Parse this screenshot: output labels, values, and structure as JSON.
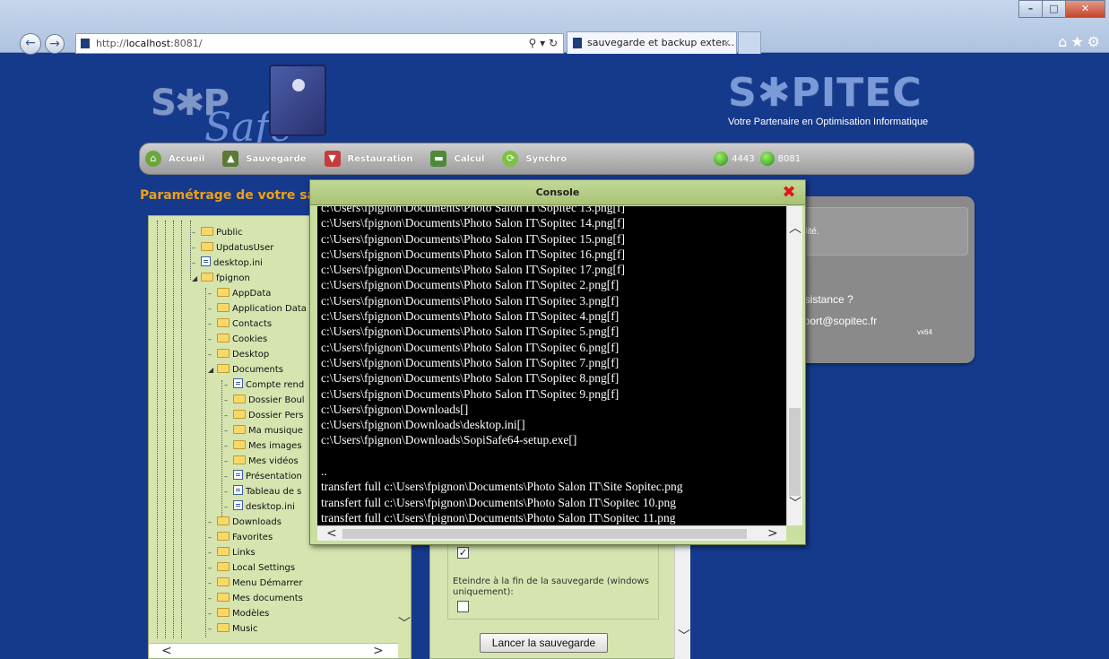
{
  "browser": {
    "address_prefix": "http://",
    "address_host": "localhost",
    "address_rest": ":8081/",
    "address_tools": "⚲ ▾ ↻",
    "tab_title": "sauvegarde et backup exter...",
    "tab_close": "×",
    "window_buttons": {
      "minimize": "–",
      "maximize": "□",
      "close": "✕"
    },
    "back_icon": "←",
    "forward_icon": "→",
    "right_icons": "⌂★⚙"
  },
  "header": {
    "sopisafe_word": "S✱P",
    "sopisafe_script": "Safe",
    "sopitec_brand": "S✱PITEC",
    "sopitec_tagline": "Votre Partenaire en Optimisation Informatique"
  },
  "menu": {
    "items": [
      {
        "label": "Accueil",
        "icon": "home-icon",
        "color": "#6aa63a"
      },
      {
        "label": "Sauvegarde",
        "icon": "backup-icon",
        "color": "#5b7a36"
      },
      {
        "label": "Restauration",
        "icon": "restore-icon",
        "color": "#c43c3c"
      },
      {
        "label": "Calcul",
        "icon": "calculator-icon",
        "color": "#4e8a3a"
      },
      {
        "label": "Synchro",
        "icon": "sync-icon",
        "color": "#7cc243"
      }
    ],
    "status": [
      {
        "label": "4443",
        "color": "#3aa81f"
      },
      {
        "label": "8081",
        "color": "#3aa81f"
      }
    ]
  },
  "page_title": "Paramétrage de votre sa",
  "tree": {
    "items": [
      {
        "label": "Public",
        "type": "folder"
      },
      {
        "label": "UpdatusUser",
        "type": "folder"
      },
      {
        "label": "desktop.ini",
        "type": "file"
      },
      {
        "label": "fpignon",
        "type": "folder",
        "expanded": true
      },
      {
        "label": "AppData",
        "type": "folder"
      },
      {
        "label": "Application Data",
        "type": "folder"
      },
      {
        "label": "Contacts",
        "type": "folder"
      },
      {
        "label": "Cookies",
        "type": "folder"
      },
      {
        "label": "Desktop",
        "type": "folder"
      },
      {
        "label": "Documents",
        "type": "folder",
        "expanded": true
      },
      {
        "label": "Compte rend",
        "type": "file"
      },
      {
        "label": "Dossier Boul",
        "type": "folder"
      },
      {
        "label": "Dossier Pers",
        "type": "folder"
      },
      {
        "label": "Ma musique",
        "type": "folder"
      },
      {
        "label": "Mes images",
        "type": "folder"
      },
      {
        "label": "Mes vidéos",
        "type": "folder"
      },
      {
        "label": "Présentation",
        "type": "file"
      },
      {
        "label": "Tableau de s",
        "type": "file"
      },
      {
        "label": "desktop.ini",
        "type": "file"
      },
      {
        "label": "Downloads",
        "type": "folder"
      },
      {
        "label": "Favorites",
        "type": "folder"
      },
      {
        "label": "Links",
        "type": "folder"
      },
      {
        "label": "Local Settings",
        "type": "folder"
      },
      {
        "label": "Menu Démarrer",
        "type": "folder"
      },
      {
        "label": "Mes documents",
        "type": "folder"
      },
      {
        "label": "Modèles",
        "type": "folder"
      },
      {
        "label": "Music",
        "type": "folder"
      }
    ]
  },
  "options": {
    "checkbox_1_checked": true,
    "shutdown_label": "Eteindre à la fin de la sauvegarde (windows uniquement):",
    "shutdown_checked": false,
    "start_button": "Lancer la sauvegarde"
  },
  "info": {
    "notice_text": "lité.",
    "assistance_text": "assistance ?",
    "support_text": "pport@sopitec.fr",
    "version_text": "vx64"
  },
  "console": {
    "title": "Console",
    "close_icon": "✖",
    "lines": [
      "c:\\Users\\fpignon\\Documents\\Photo Salon IT\\Sopitec 13.png[f]",
      "c:\\Users\\fpignon\\Documents\\Photo Salon IT\\Sopitec 14.png[f]",
      "c:\\Users\\fpignon\\Documents\\Photo Salon IT\\Sopitec 15.png[f]",
      "c:\\Users\\fpignon\\Documents\\Photo Salon IT\\Sopitec 16.png[f]",
      "c:\\Users\\fpignon\\Documents\\Photo Salon IT\\Sopitec 17.png[f]",
      "c:\\Users\\fpignon\\Documents\\Photo Salon IT\\Sopitec 2.png[f]",
      "c:\\Users\\fpignon\\Documents\\Photo Salon IT\\Sopitec 3.png[f]",
      "c:\\Users\\fpignon\\Documents\\Photo Salon IT\\Sopitec 4.png[f]",
      "c:\\Users\\fpignon\\Documents\\Photo Salon IT\\Sopitec 5.png[f]",
      "c:\\Users\\fpignon\\Documents\\Photo Salon IT\\Sopitec 6.png[f]",
      "c:\\Users\\fpignon\\Documents\\Photo Salon IT\\Sopitec 7.png[f]",
      "c:\\Users\\fpignon\\Documents\\Photo Salon IT\\Sopitec 8.png[f]",
      "c:\\Users\\fpignon\\Documents\\Photo Salon IT\\Sopitec 9.png[f]",
      "c:\\Users\\fpignon\\Downloads[]",
      "c:\\Users\\fpignon\\Downloads\\desktop.ini[]",
      "c:\\Users\\fpignon\\Downloads\\SopiSafe64-setup.exe[]",
      "",
      "..",
      "transfert full c:\\Users\\fpignon\\Documents\\Photo Salon IT\\Site Sopitec.png",
      "transfert full c:\\Users\\fpignon\\Documents\\Photo Salon IT\\Sopitec 10.png",
      "transfert full c:\\Users\\fpignon\\Documents\\Photo Salon IT\\Sopitec 11.png"
    ],
    "scroll_up": "︿",
    "scroll_down": "﹀",
    "scroll_left": "<",
    "scroll_right": ">"
  }
}
